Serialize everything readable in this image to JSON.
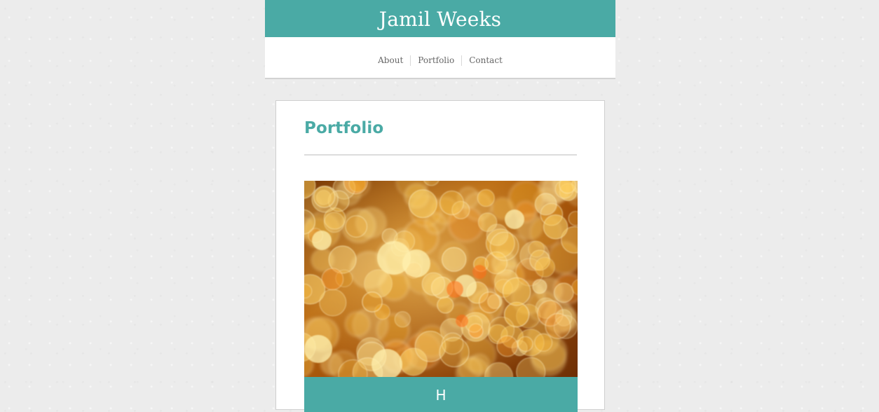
{
  "header": {
    "site_title": "Jamil Weeks",
    "accent_color": "#4aaaa5"
  },
  "nav": {
    "items": [
      {
        "label": "About"
      },
      {
        "label": "Portfolio"
      },
      {
        "label": "Contact"
      }
    ]
  },
  "main": {
    "page_title": "Portfolio",
    "portfolio": {
      "items": [
        {
          "image_subject": "golden bokeh lights",
          "caption": "H"
        }
      ]
    }
  }
}
